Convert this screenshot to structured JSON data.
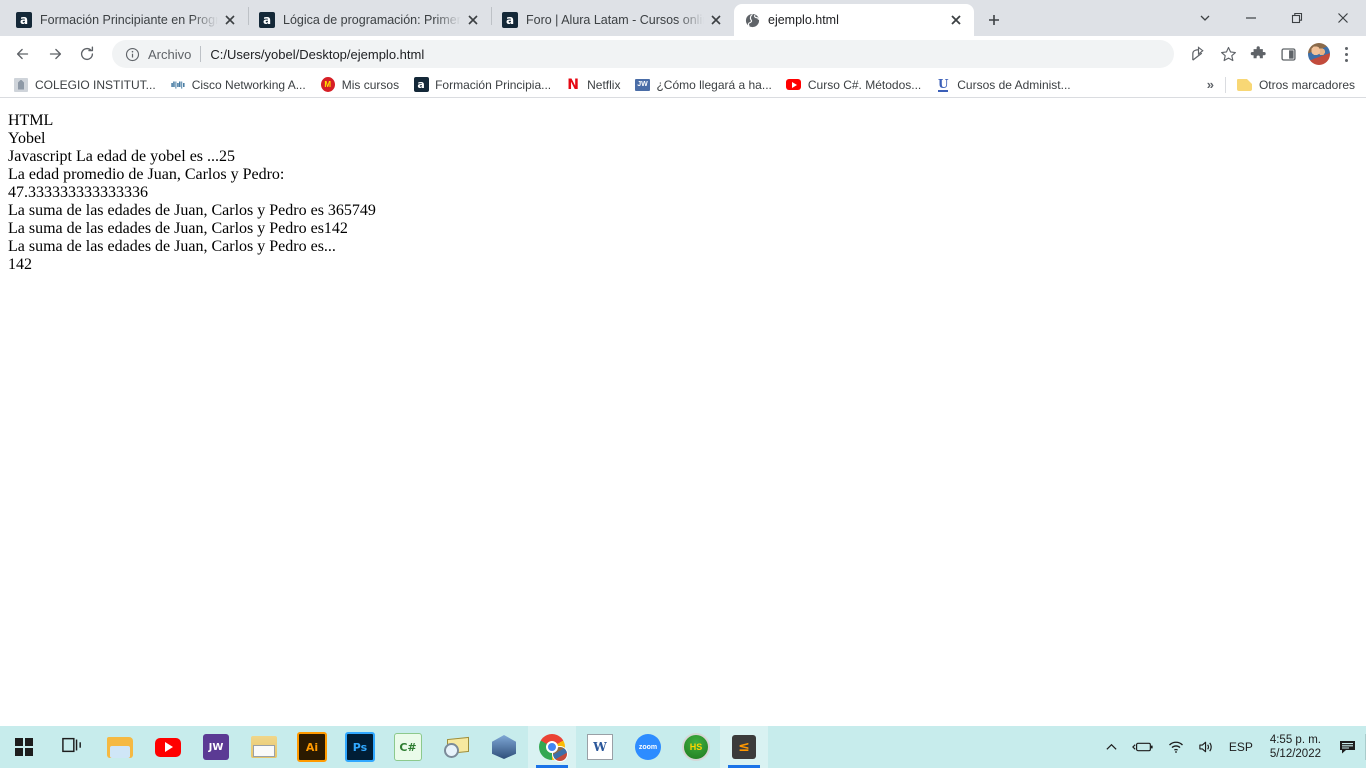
{
  "window": {
    "controls": [
      {
        "name": "tab-search",
        "glyph": "⌄"
      },
      {
        "name": "minimize",
        "glyph": "—"
      },
      {
        "name": "maximize",
        "glyph": "❐"
      },
      {
        "name": "close",
        "glyph": "✕"
      }
    ]
  },
  "tabs": [
    {
      "title": "Formación Principiante en Progra",
      "favicon": "alura-icon",
      "active": false
    },
    {
      "title": "Lógica de programación: Primero",
      "favicon": "alura-icon",
      "active": false
    },
    {
      "title": "Foro | Alura Latam - Cursos onlin",
      "favicon": "alura-icon",
      "active": false
    },
    {
      "title": "ejemplo.html",
      "favicon": "globe-icon",
      "active": true
    }
  ],
  "new_tab_label": "+",
  "toolbar": {
    "back_label": "←",
    "forward_label": "→",
    "reload_label": "⟳",
    "omnibox": {
      "scheme_label": "Archivo",
      "url": "C:/Users/yobel/Desktop/ejemplo.html"
    },
    "share_label": "share-icon",
    "bookmark_star_label": "★",
    "extensions_label": "puzzle-icon",
    "sidepanel_label": "panel-icon",
    "profile_label": "avatar",
    "menu_label": "⋮"
  },
  "bookmarks": {
    "items": [
      {
        "label": "COLEGIO INSTITUT...",
        "icon": "colegio-icon"
      },
      {
        "label": "Cisco Networking A...",
        "icon": "cisco-icon"
      },
      {
        "label": "Mis cursos",
        "icon": "miscursos-icon"
      },
      {
        "label": "Formación Principia...",
        "icon": "alura-icon"
      },
      {
        "label": "Netflix",
        "icon": "netflix-icon"
      },
      {
        "label": "¿Cómo llegará a ha...",
        "icon": "jw-icon"
      },
      {
        "label": "Curso C#. Métodos...",
        "icon": "youtube-icon"
      },
      {
        "label": "Cursos de Administ...",
        "icon": "udemy-icon"
      }
    ],
    "overflow_label": "»",
    "other_bookmarks_label": "Otros marcadores"
  },
  "page": {
    "lines": [
      "HTML",
      "Yobel",
      "Javascript La edad de yobel es ...25",
      "La edad promedio de Juan, Carlos y Pedro:",
      "47.333333333333336",
      "La suma de las edades de Juan, Carlos y Pedro es 365749",
      "La suma de las edades de Juan, Carlos y Pedro es142",
      "La suma de las edades de Juan, Carlos y Pedro es...",
      "142"
    ]
  },
  "taskbar": {
    "items": [
      {
        "name": "start-button",
        "icon": "windows-logo-icon",
        "label": ""
      },
      {
        "name": "task-view-button",
        "icon": "task-view-icon",
        "label": ""
      },
      {
        "name": "file-explorer",
        "icon": "explorer-icon",
        "label": ""
      },
      {
        "name": "youtube",
        "icon": "youtube-icon",
        "label": ""
      },
      {
        "name": "jw-library",
        "icon": "jw-icon",
        "label": "JW"
      },
      {
        "name": "biblia-app",
        "icon": "biblia-icon",
        "label": ""
      },
      {
        "name": "illustrator",
        "icon": "illustrator-icon",
        "label": "Ai"
      },
      {
        "name": "photoshop",
        "icon": "photoshop-icon",
        "label": "Ps"
      },
      {
        "name": "csharp-app",
        "icon": "csharp-icon",
        "label": "C#"
      },
      {
        "name": "mail-search-app",
        "icon": "mail-icon",
        "label": ""
      },
      {
        "name": "virtualbox",
        "icon": "virtualbox-icon",
        "label": ""
      },
      {
        "name": "chrome",
        "icon": "chrome-icon",
        "label": "",
        "active": true
      },
      {
        "name": "word",
        "icon": "word-icon",
        "label": "W"
      },
      {
        "name": "zoom",
        "icon": "zoom-icon",
        "label": "zoom"
      },
      {
        "name": "hs-app",
        "icon": "hs-icon",
        "label": "HS"
      },
      {
        "name": "sublime-text",
        "icon": "sublime-icon",
        "label": "≤",
        "active2": true
      }
    ],
    "tray": {
      "show_hidden_label": "⌃",
      "battery_label": "battery-icon",
      "wifi_label": "wifi-icon",
      "volume_label": "volume-icon",
      "language_label": "ESP",
      "time": "4:55 p. m.",
      "date": "5/12/2022",
      "notifications_label": "notifications-icon"
    }
  }
}
